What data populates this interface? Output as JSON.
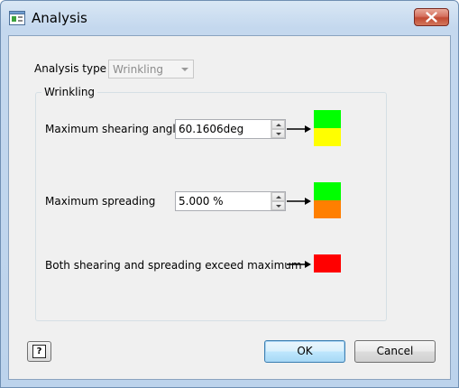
{
  "window": {
    "title": "Analysis"
  },
  "form": {
    "analysis_type_label": "Analysis type",
    "analysis_type_value": "Wrinkling"
  },
  "group": {
    "title": "Wrinkling",
    "rows": [
      {
        "label": "Maximum shearing angle",
        "value": "60.1606deg",
        "colors": [
          "#00ff00",
          "#ffff00"
        ]
      },
      {
        "label": "Maximum spreading",
        "value": "5.000 %",
        "colors": [
          "#00ff00",
          "#ff7f00"
        ]
      },
      {
        "label": "Both shearing and spreading exceed maximum",
        "colors": [
          "#ff0000"
        ]
      }
    ]
  },
  "buttons": {
    "help_glyph": "?",
    "ok": "OK",
    "cancel": "Cancel"
  }
}
